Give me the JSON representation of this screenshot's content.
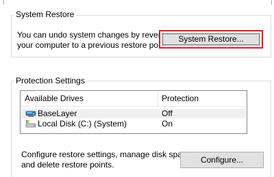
{
  "system_restore": {
    "group_title": "System Restore",
    "description_line1": "You can undo system changes by reverting",
    "description_line2": "your computer to a previous restore point.",
    "button_label": "System Restore..."
  },
  "protection": {
    "group_title": "Protection Settings",
    "columns": [
      "Available Drives",
      "Protection"
    ],
    "rows": [
      {
        "drive": "BaseLayer",
        "protection": "Off",
        "icon": "network-drive-icon"
      },
      {
        "drive": "Local Disk (C:) (System)",
        "protection": "On",
        "icon": "local-disk-icon"
      }
    ]
  },
  "configure": {
    "description_line1": "Configure restore settings, manage disk space,",
    "description_line2": "and delete restore points.",
    "button_label": "Configure..."
  },
  "colors": {
    "focus_border": "#d81e2c",
    "button_face": "#e1e1e1",
    "selected_row": "#f0f0f0"
  }
}
